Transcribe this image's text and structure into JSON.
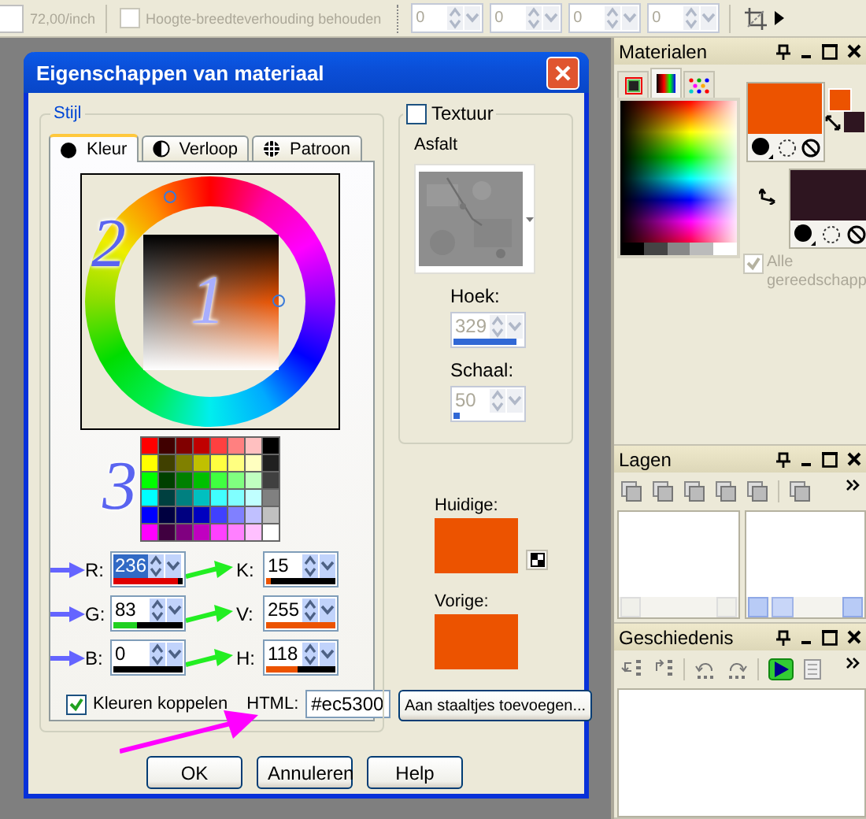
{
  "toolbar": {
    "field_value": "72,00/inch",
    "aspect_ratio": {
      "label": "Hoogte-breedteverhouding behouden",
      "checked": false,
      "disabled": true
    },
    "spin_fields": [
      {
        "value": "0",
        "disabled": true
      },
      {
        "value": "0",
        "disabled": true
      },
      {
        "value": "0",
        "disabled": true
      },
      {
        "value": "0",
        "disabled": true
      }
    ]
  },
  "dialog": {
    "title": "Eigenschappen van materiaal",
    "style": {
      "legend": "Stijl",
      "tabs": [
        {
          "label": "Kleur",
          "selected": true
        },
        {
          "label": "Verloop",
          "selected": false
        },
        {
          "label": "Patroon",
          "selected": false
        }
      ],
      "annotations": [
        "1",
        "2",
        "3"
      ],
      "palette": [
        {
          "color": "#ff0000"
        },
        {
          "color": "#400000"
        },
        {
          "color": "#800000"
        },
        {
          "color": "#c00000"
        },
        {
          "color": "#ff4040"
        },
        {
          "color": "#ff8080"
        },
        {
          "color": "#ffc0c0"
        },
        {
          "color": "#000000"
        },
        {
          "color": "#ffff00"
        },
        {
          "color": "#404000"
        },
        {
          "color": "#808000"
        },
        {
          "color": "#c0c000"
        },
        {
          "color": "#ffff40"
        },
        {
          "color": "#ffff80"
        },
        {
          "color": "#ffffc0"
        },
        {
          "color": "#202020"
        },
        {
          "color": "#00ff00"
        },
        {
          "color": "#004000"
        },
        {
          "color": "#008000"
        },
        {
          "color": "#00c000"
        },
        {
          "color": "#40ff40"
        },
        {
          "color": "#80ff80"
        },
        {
          "color": "#c0ffc0"
        },
        {
          "color": "#404040"
        },
        {
          "color": "#00ffff"
        },
        {
          "color": "#004040"
        },
        {
          "color": "#008080"
        },
        {
          "color": "#00c0c0"
        },
        {
          "color": "#40ffff"
        },
        {
          "color": "#80ffff"
        },
        {
          "color": "#c0ffff"
        },
        {
          "color": "#808080"
        },
        {
          "color": "#0000ff"
        },
        {
          "color": "#000040"
        },
        {
          "color": "#000080"
        },
        {
          "color": "#0000c0"
        },
        {
          "color": "#4040ff"
        },
        {
          "color": "#8080ff"
        },
        {
          "color": "#c0c0ff"
        },
        {
          "color": "#c0c0c0"
        },
        {
          "color": "#ff00ff"
        },
        {
          "color": "#400040"
        },
        {
          "color": "#800080"
        },
        {
          "color": "#c000c0"
        },
        {
          "color": "#ff40ff"
        },
        {
          "color": "#ff80ff"
        },
        {
          "color": "#ffc0ff"
        },
        {
          "color": "#ffffff"
        }
      ],
      "rgb": [
        {
          "label": "R:",
          "value": "236",
          "selected": true,
          "level": 0.93,
          "color": "#e00000"
        },
        {
          "label": "G:",
          "value": "83",
          "selected": false,
          "level": 0.33,
          "color": "#20d020"
        },
        {
          "label": "B:",
          "value": "0",
          "selected": false,
          "level": 0
        }
      ],
      "hsv": [
        {
          "label": "K:",
          "value": "15",
          "selected": false,
          "level": 0.06,
          "color": "#ec5300"
        },
        {
          "label": "V:",
          "value": "255",
          "selected": false,
          "level": 1,
          "color": "#ec5300"
        },
        {
          "label": "H:",
          "value": "118",
          "selected": false,
          "level": 0.46,
          "color": "#ec5300"
        }
      ],
      "link_colors": {
        "label": "Kleuren koppelen",
        "checked": true
      },
      "html": {
        "label": "HTML:",
        "value": "#ec5300"
      }
    },
    "texture": {
      "label": "Textuur",
      "checked": false,
      "name": "Asfalt",
      "angle": {
        "label": "Hoek:",
        "value": "329",
        "disabled": true,
        "level": 0.91
      },
      "scale": {
        "label": "Schaal:",
        "value": "50",
        "disabled": true,
        "level": 0.1
      }
    },
    "current": {
      "label": "Huidige:",
      "color": "#ec5300"
    },
    "previous": {
      "label": "Vorige:",
      "color": "#ec5300"
    },
    "add_button": "Aan staaltjes toevoegen...",
    "buttons": [
      "OK",
      "Annuleren",
      "Help"
    ]
  },
  "materials": {
    "title": "Materialen",
    "tabs": [
      {
        "kind": "frame",
        "selected": false
      },
      {
        "kind": "spectrum",
        "selected": true
      },
      {
        "kind": "swatches",
        "selected": false
      }
    ],
    "foreground": {
      "color": "#ec5300"
    },
    "background": {
      "color": "#2e1520"
    },
    "all_tools": {
      "label": "Alle gereedschapp",
      "checked": true,
      "disabled": true
    }
  },
  "layers": {
    "title": "Lagen"
  },
  "history": {
    "title": "Geschiedenis"
  }
}
